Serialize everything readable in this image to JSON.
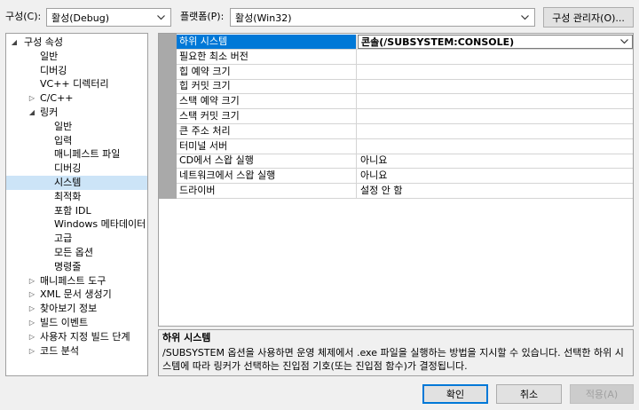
{
  "header": {
    "config_label": "구성(C):",
    "config_value": "활성(Debug)",
    "platform_label": "플랫폼(P):",
    "platform_value": "활성(Win32)",
    "config_manager_label": "구성 관리자(O)..."
  },
  "tree": {
    "items": [
      {
        "label": "구성 속성",
        "arrow": "◢"
      },
      {
        "label": "일반"
      },
      {
        "label": "디버깅"
      },
      {
        "label": "VC++ 디렉터리"
      },
      {
        "label": "C/C++",
        "arrow": "▷"
      },
      {
        "label": "링커",
        "arrow": "◢"
      },
      {
        "label": "일반"
      },
      {
        "label": "입력"
      },
      {
        "label": "매니페스트 파일"
      },
      {
        "label": "디버깅"
      },
      {
        "label": "시스템"
      },
      {
        "label": "최적화"
      },
      {
        "label": "포함 IDL"
      },
      {
        "label": "Windows 메타데이터"
      },
      {
        "label": "고급"
      },
      {
        "label": "모든 옵션"
      },
      {
        "label": "명령줄"
      },
      {
        "label": "매니페스트 도구",
        "arrow": "▷"
      },
      {
        "label": "XML 문서 생성기",
        "arrow": "▷"
      },
      {
        "label": "찾아보기 정보",
        "arrow": "▷"
      },
      {
        "label": "빌드 이벤트",
        "arrow": "▷"
      },
      {
        "label": "사용자 지정 빌드 단계",
        "arrow": "▷"
      },
      {
        "label": "코드 분석",
        "arrow": "▷"
      }
    ]
  },
  "properties": [
    {
      "name": "하위 시스템",
      "value": "콘솔(/SUBSYSTEM:CONSOLE)"
    },
    {
      "name": "필요한 최소 버전",
      "value": ""
    },
    {
      "name": "힙 예약 크기",
      "value": ""
    },
    {
      "name": "힙 커밋 크기",
      "value": ""
    },
    {
      "name": "스택 예약 크기",
      "value": ""
    },
    {
      "name": "스택 커밋 크기",
      "value": ""
    },
    {
      "name": "큰 주소 처리",
      "value": ""
    },
    {
      "name": "터미널 서버",
      "value": ""
    },
    {
      "name": "CD에서 스왑 실행",
      "value": "아니요"
    },
    {
      "name": "네트워크에서 스왑 실행",
      "value": "아니요"
    },
    {
      "name": "드라이버",
      "value": "설정 안 함"
    }
  ],
  "description": {
    "title": "하위 시스템",
    "line1": "/SUBSYSTEM 옵션을 사용하면 운영 체제에서 .exe 파일을 실행하는 방법을 지시할 수 있습니다. 선택한 하위 시",
    "line2": "스템에 따라 링커가 선택하는 진입점 기호(또는 진입점 함수)가 결정됩니다."
  },
  "footer": {
    "ok_label": "확인",
    "cancel_label": "취소",
    "apply_label": "적용(A)"
  },
  "colors": {
    "selection": "#0078d7",
    "tree_selection": "#cce4f7",
    "gutter": "#a9a9a9"
  }
}
